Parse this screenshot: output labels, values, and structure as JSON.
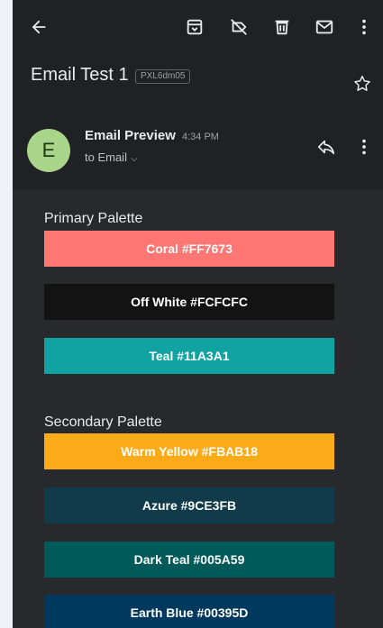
{
  "toolbar": {
    "back_icon": "arrow-back-icon",
    "actions": [
      "archive-icon",
      "label-off-icon",
      "delete-icon",
      "mail-icon",
      "more-vert-icon"
    ]
  },
  "email": {
    "subject": "Email Test 1",
    "label": "PXL6dm05",
    "star_icon": "star-outline-icon"
  },
  "sender": {
    "initial": "E",
    "name": "Email Preview",
    "time": "4:34 PM",
    "recipient": "to Email",
    "avatar_color": "#a8d58a"
  },
  "palettes": {
    "primary": {
      "title": "Primary Palette",
      "swatches": [
        {
          "label": "Coral #FF7673",
          "color": "#ff7673"
        },
        {
          "label": "Off White #FCFCFC",
          "color": "#131314"
        },
        {
          "label": "Teal #11A3A1",
          "color": "#11a3a1"
        }
      ]
    },
    "secondary": {
      "title": "Secondary Palette",
      "swatches": [
        {
          "label": "Warm Yellow #FBAB18",
          "color": "#fbab18"
        },
        {
          "label": "Azure #9CE3FB",
          "color": "#0f3b4a"
        },
        {
          "label": "Dark Teal #005A59",
          "color": "#005a59"
        },
        {
          "label": "Earth Blue #00395D",
          "color": "#00395d"
        }
      ]
    }
  }
}
